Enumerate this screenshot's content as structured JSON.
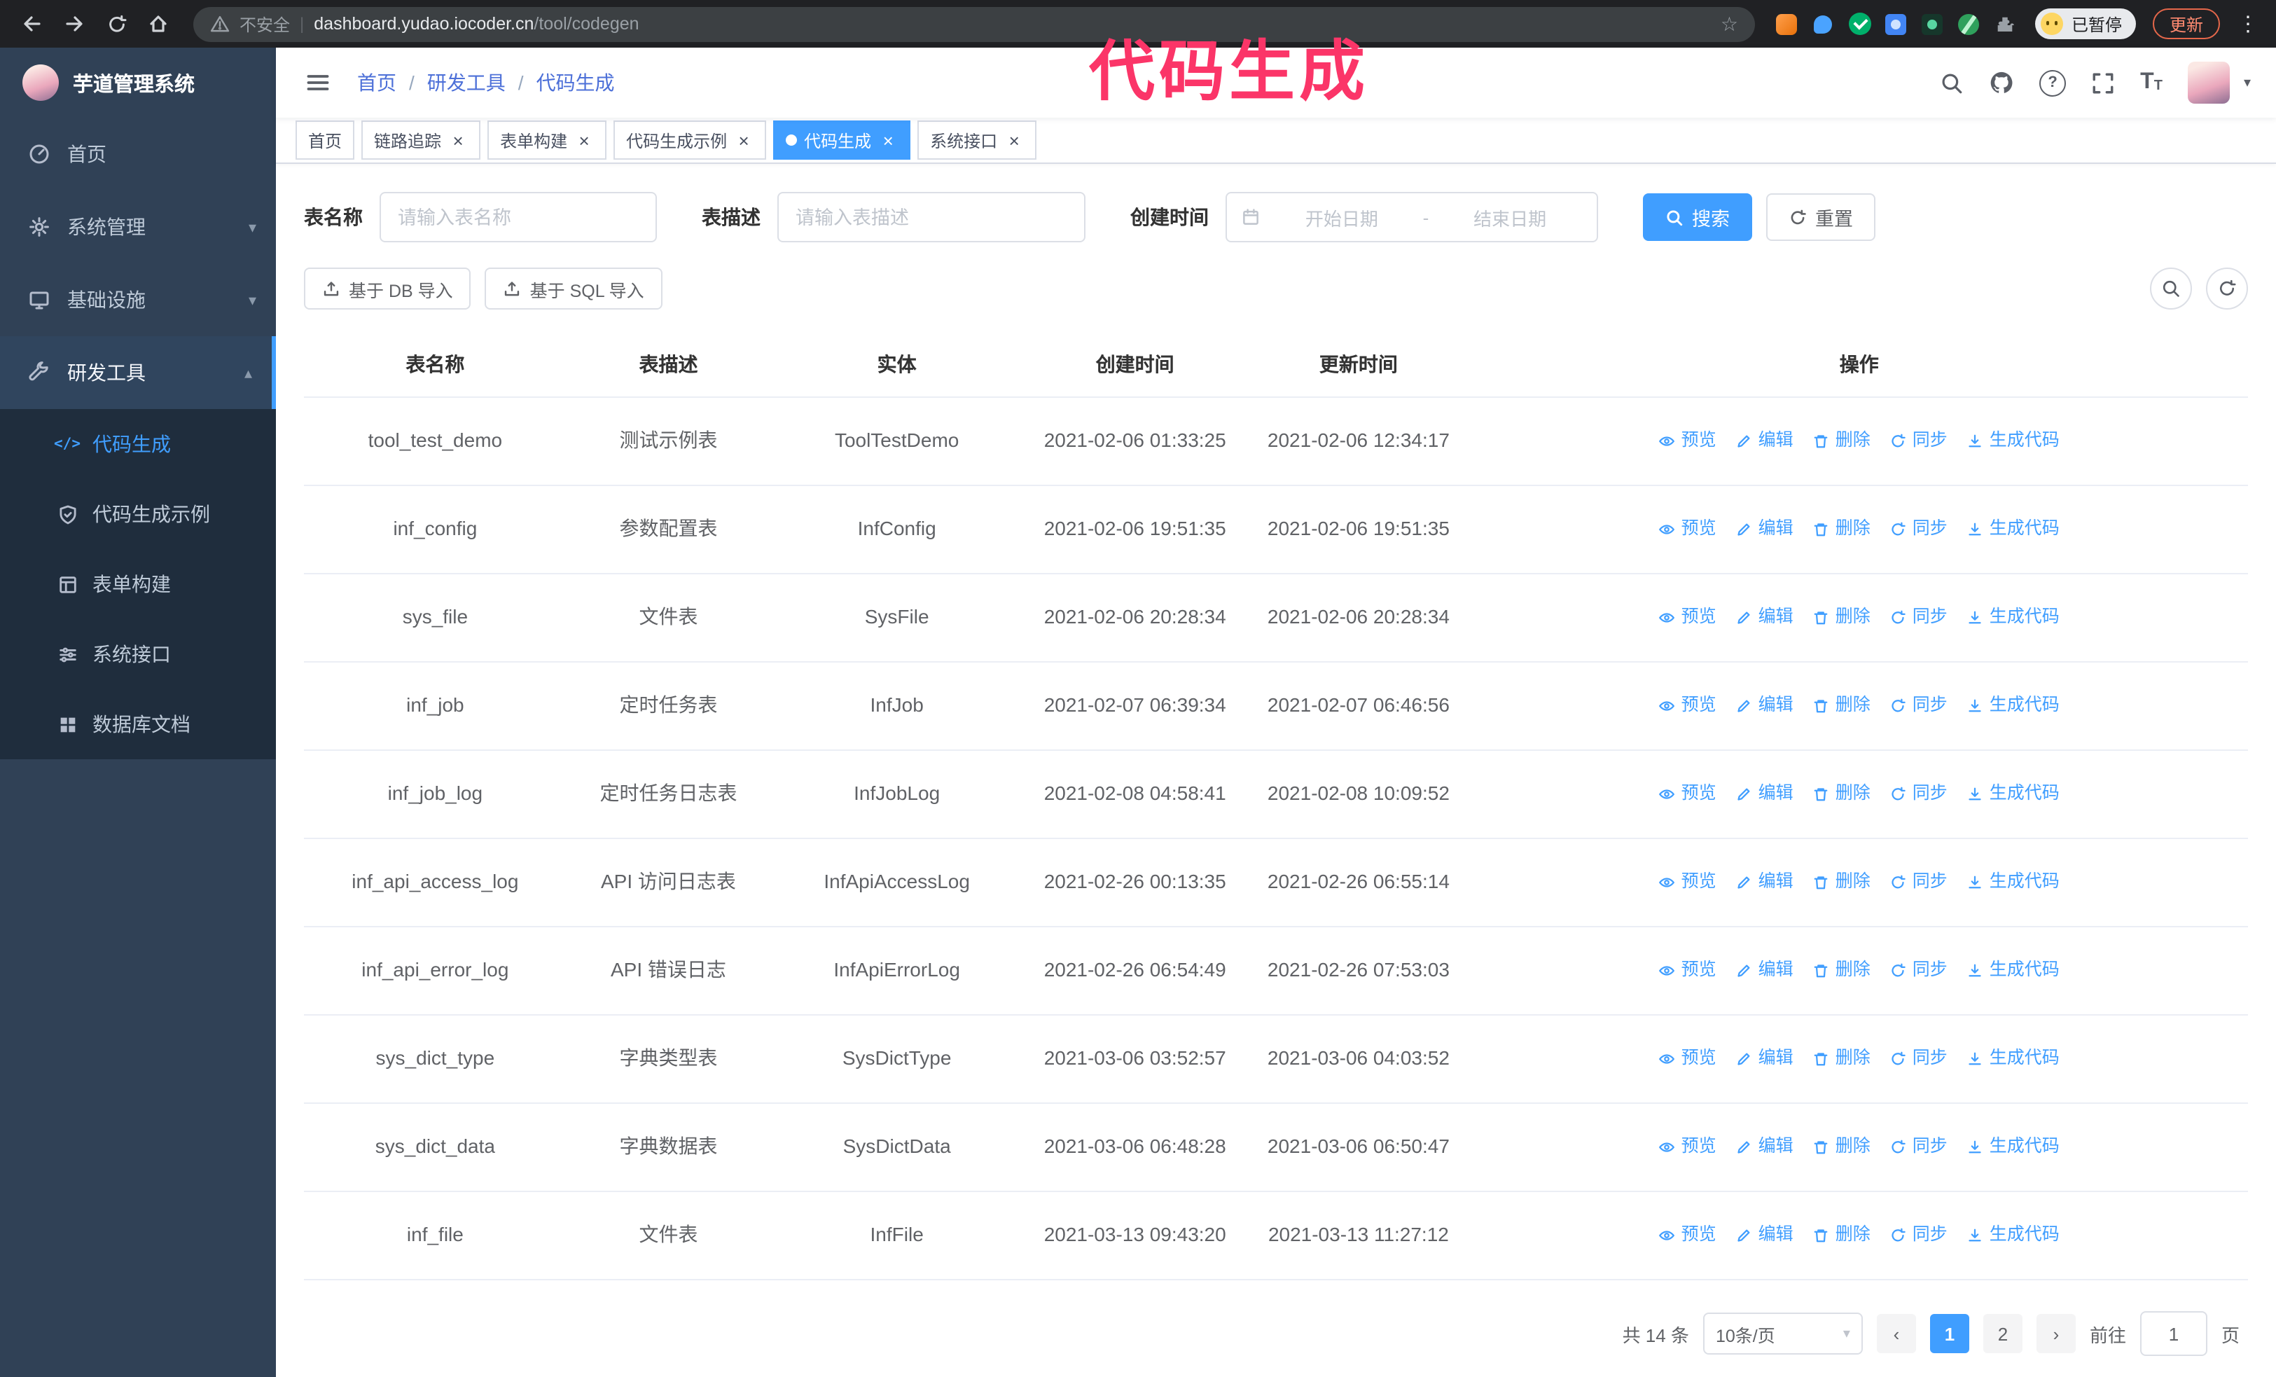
{
  "annotation": {
    "text": "代码生成",
    "color": "#fb3568"
  },
  "browser": {
    "security_label": "不安全",
    "url_domain": "dashboard.yudao.iocoder.cn",
    "url_path": "/tool/codegen",
    "profile_badge": "已暂停",
    "update_label": "更新"
  },
  "glyphs": {
    "close": "×",
    "caret_down": "▾",
    "caret_up": "▴",
    "star": "☆",
    "chevron_left": "‹",
    "chevron_right": "›",
    "more_dots": "⋮",
    "divider": "|",
    "question": "?",
    "t_large": "T",
    "t_small": "T",
    "code": "</>"
  },
  "sidebar": {
    "logo_title": "芋道管理系统",
    "items": [
      {
        "label": "首页",
        "expandable": false
      },
      {
        "label": "系统管理",
        "expandable": true
      },
      {
        "label": "基础设施",
        "expandable": true
      },
      {
        "label": "研发工具",
        "expandable": true,
        "expanded": true
      }
    ],
    "subitems": [
      {
        "label": "代码生成",
        "active": true
      },
      {
        "label": "代码生成示例"
      },
      {
        "label": "表单构建"
      },
      {
        "label": "系统接口"
      },
      {
        "label": "数据库文档"
      }
    ]
  },
  "navbar": {
    "breadcrumb": [
      "首页",
      "研发工具",
      "代码生成"
    ],
    "separator": "/"
  },
  "tabs": [
    {
      "label": "首页",
      "closable": false
    },
    {
      "label": "链路追踪",
      "closable": true
    },
    {
      "label": "表单构建",
      "closable": true
    },
    {
      "label": "代码生成示例",
      "closable": true
    },
    {
      "label": "代码生成",
      "closable": true,
      "active": true
    },
    {
      "label": "系统接口",
      "closable": true
    }
  ],
  "filters": {
    "name_label": "表名称",
    "name_placeholder": "请输入表名称",
    "desc_label": "表描述",
    "desc_placeholder": "请输入表描述",
    "time_label": "创建时间",
    "start_placeholder": "开始日期",
    "range_separator": "-",
    "end_placeholder": "结束日期",
    "search_label": "搜索",
    "reset_label": "重置"
  },
  "toolbar": {
    "db_import_label": "基于 DB 导入",
    "sql_import_label": "基于 SQL 导入"
  },
  "table": {
    "columns": [
      "表名称",
      "表描述",
      "实体",
      "创建时间",
      "更新时间",
      "操作"
    ],
    "ops": {
      "preview": "预览",
      "edit": "编辑",
      "delete": "删除",
      "sync": "同步",
      "generate": "生成代码"
    },
    "rows": [
      {
        "name": "tool_test_demo",
        "description": "测试示例表",
        "entity": "ToolTestDemo",
        "create_time": "2021-02-06 01:33:25",
        "update_time": "2021-02-06 12:34:17"
      },
      {
        "name": "inf_config",
        "description": "参数配置表",
        "entity": "InfConfig",
        "create_time": "2021-02-06 19:51:35",
        "update_time": "2021-02-06 19:51:35"
      },
      {
        "name": "sys_file",
        "description": "文件表",
        "entity": "SysFile",
        "create_time": "2021-02-06 20:28:34",
        "update_time": "2021-02-06 20:28:34"
      },
      {
        "name": "inf_job",
        "description": "定时任务表",
        "entity": "InfJob",
        "create_time": "2021-02-07 06:39:34",
        "update_time": "2021-02-07 06:46:56"
      },
      {
        "name": "inf_job_log",
        "description": "定时任务日志表",
        "entity": "InfJobLog",
        "create_time": "2021-02-08 04:58:41",
        "update_time": "2021-02-08 10:09:52"
      },
      {
        "name": "inf_api_access_log",
        "description": "API 访问日志表",
        "entity": "InfApiAccessLog",
        "create_time": "2021-02-26 00:13:35",
        "update_time": "2021-02-26 06:55:14"
      },
      {
        "name": "inf_api_error_log",
        "description": "API 错误日志",
        "entity": "InfApiErrorLog",
        "create_time": "2021-02-26 06:54:49",
        "update_time": "2021-02-26 07:53:03"
      },
      {
        "name": "sys_dict_type",
        "description": "字典类型表",
        "entity": "SysDictType",
        "create_time": "2021-03-06 03:52:57",
        "update_time": "2021-03-06 04:03:52"
      },
      {
        "name": "sys_dict_data",
        "description": "字典数据表",
        "entity": "SysDictData",
        "create_time": "2021-03-06 06:48:28",
        "update_time": "2021-03-06 06:50:47"
      },
      {
        "name": "inf_file",
        "description": "文件表",
        "entity": "InfFile",
        "create_time": "2021-03-13 09:43:20",
        "update_time": "2021-03-13 11:27:12"
      }
    ]
  },
  "pagination": {
    "total": "共 14 条",
    "page_size": "10条/页",
    "pages": [
      "1",
      "2"
    ],
    "current": "1",
    "goto_label": "前往",
    "goto_value": "1",
    "goto_unit": "页"
  },
  "colors": {
    "primary": "#409eff",
    "sidebar_bg": "#304156",
    "submenu_bg": "#1f2d3d",
    "browser_bg": "#202124",
    "annotation": "#fb3568"
  }
}
